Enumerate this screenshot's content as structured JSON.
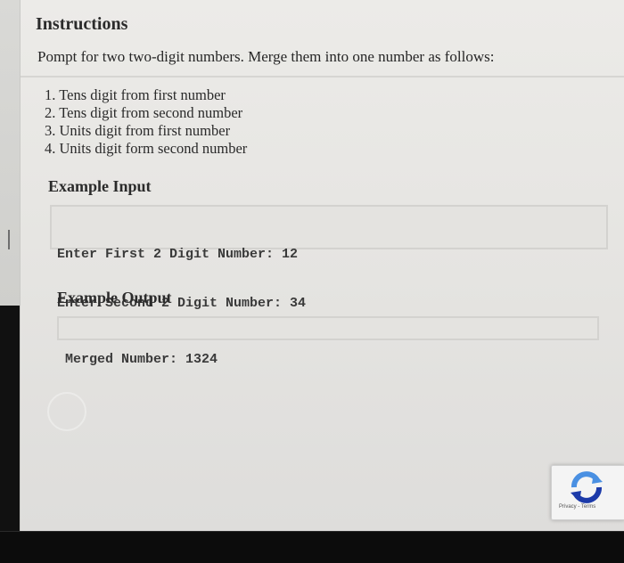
{
  "instructions": {
    "title": "Instructions",
    "prompt": "Pompt for two two-digit numbers. Merge them into one number as follows:",
    "steps": [
      "1. Tens digit from first number",
      "2. Tens digit from second number",
      "3. Units digit from first number",
      "4. Units digit form second number"
    ]
  },
  "example_input": {
    "heading": "Example Input",
    "lines": [
      "Enter First 2 Digit Number: 12",
      "Enter Second 2 Digit Number: 34"
    ]
  },
  "example_output": {
    "heading": "Example Output",
    "lines": [
      "Merged Number: 1324"
    ]
  },
  "recaptcha": {
    "icon": "recaptcha-icon",
    "terms": "Privacy - Terms"
  },
  "colors": {
    "page_background": "#ecebe8",
    "code_background": "#e4e3e0",
    "screen_bezel": "#111111"
  }
}
